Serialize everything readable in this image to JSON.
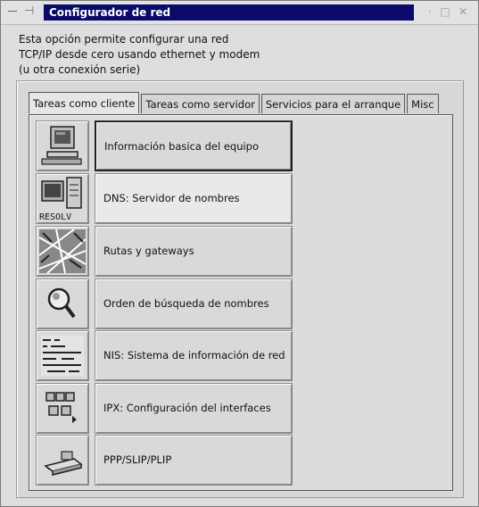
{
  "window": {
    "title": "Configurador de red"
  },
  "description": {
    "line1": "Esta opción permite configurar una red",
    "line2": "TCP/IP desde cero usando ethernet y modem",
    "line3": "(u otra conexión serie)"
  },
  "tabs": [
    {
      "label": "Tareas como cliente",
      "active": true
    },
    {
      "label": "Tareas como servidor"
    },
    {
      "label": "Servicios para el arranque"
    },
    {
      "label": "Misc"
    }
  ],
  "items": [
    {
      "label": "Información basica del equipo",
      "icon": "computer-icon"
    },
    {
      "label": "DNS: Servidor de nombres",
      "icon": "dns-resolv-icon",
      "icon_text": "RESOLV"
    },
    {
      "label": "Rutas y gateways",
      "icon": "routes-map-icon"
    },
    {
      "label": "Orden de búsqueda de nombres",
      "icon": "magnifier-icon"
    },
    {
      "label": "NIS: Sistema de información de red",
      "icon": "nis-list-icon"
    },
    {
      "label": "IPX: Configuración del interfaces",
      "icon": "ipx-network-icon"
    },
    {
      "label": "PPP/SLIP/PLIP",
      "icon": "modem-icon"
    }
  ]
}
